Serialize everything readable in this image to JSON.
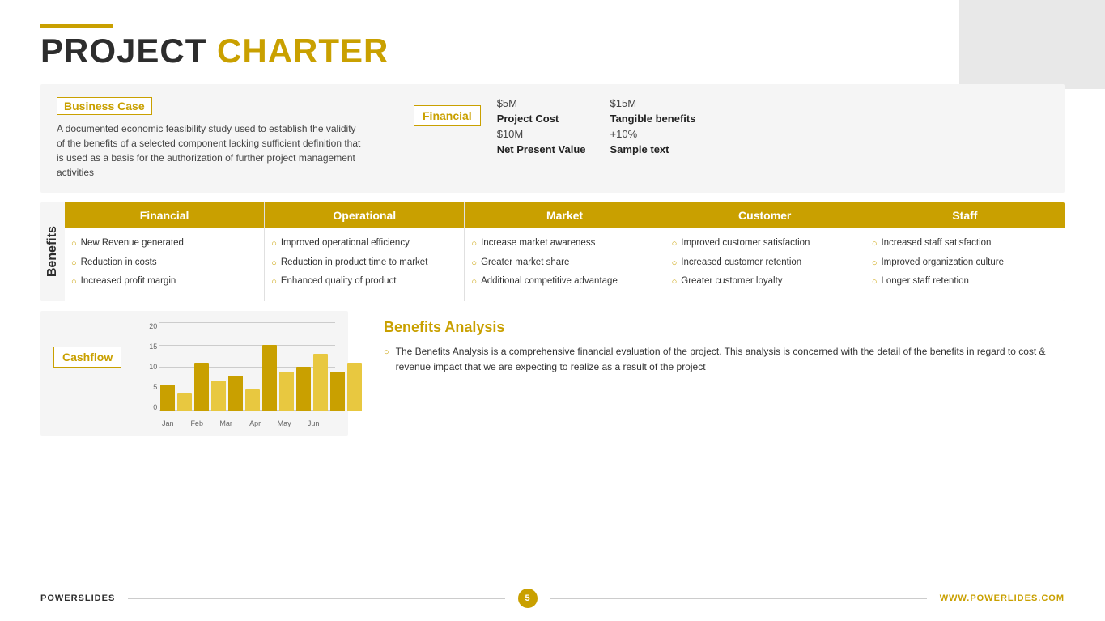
{
  "page": {
    "title_part1": "PROJECT",
    "title_part2": "CHARTER"
  },
  "header_line": true,
  "business_case": {
    "label": "Business Case",
    "text": "A documented economic feasibility study used to establish the validity of the benefits of a selected component lacking sufficient definition that is used as a basis for the authorization of further project management activities"
  },
  "financial": {
    "label": "Financial",
    "items": [
      {
        "value": "$5M",
        "label": "Project Cost"
      },
      {
        "value": "$15M",
        "label": "Tangible benefits"
      },
      {
        "value": "$10M",
        "label": "Net Present Value"
      },
      {
        "value": "+10%",
        "label": "Sample text"
      }
    ]
  },
  "benefits": {
    "label": "Benefits",
    "columns": [
      {
        "header": "Financial",
        "items": [
          "New Revenue generated",
          "Reduction in costs",
          "Increased profit margin"
        ]
      },
      {
        "header": "Operational",
        "items": [
          "Improved operational efficiency",
          "Reduction in product time to market",
          "Enhanced quality of product"
        ]
      },
      {
        "header": "Market",
        "items": [
          "Increase market awareness",
          "Greater market share",
          "Additional competitive advantage"
        ]
      },
      {
        "header": "Customer",
        "items": [
          "Improved customer satisfaction",
          "Increased customer retention",
          "Greater customer loyalty"
        ]
      },
      {
        "header": "Staff",
        "items": [
          "Increased staff satisfaction",
          "Improved organization culture",
          "Longer staff retention"
        ]
      }
    ]
  },
  "cashflow": {
    "label": "Cashflow",
    "y_labels": [
      "20",
      "15",
      "10",
      "5",
      "0"
    ],
    "bars": [
      {
        "month": "Jan",
        "value1": 6,
        "value2": 4
      },
      {
        "month": "Feb",
        "value1": 11,
        "value2": 7
      },
      {
        "month": "Mar",
        "value1": 8,
        "value2": 5
      },
      {
        "month": "Apr",
        "value1": 14,
        "value2": 9
      },
      {
        "month": "May",
        "value1": 10,
        "value2": 13
      },
      {
        "month": "Jun",
        "value1": 9,
        "value2": 11
      }
    ],
    "max": 20
  },
  "benefits_analysis": {
    "title": "Benefits Analysis",
    "text": "The Benefits Analysis is a comprehensive financial evaluation of the project. This analysis is concerned with the detail of the benefits in regard to cost & revenue impact that we are expecting to realize as a result of the project"
  },
  "footer": {
    "left": "POWERSLIDES",
    "page": "5",
    "right": "WWW.POWERLIDES.COM"
  }
}
